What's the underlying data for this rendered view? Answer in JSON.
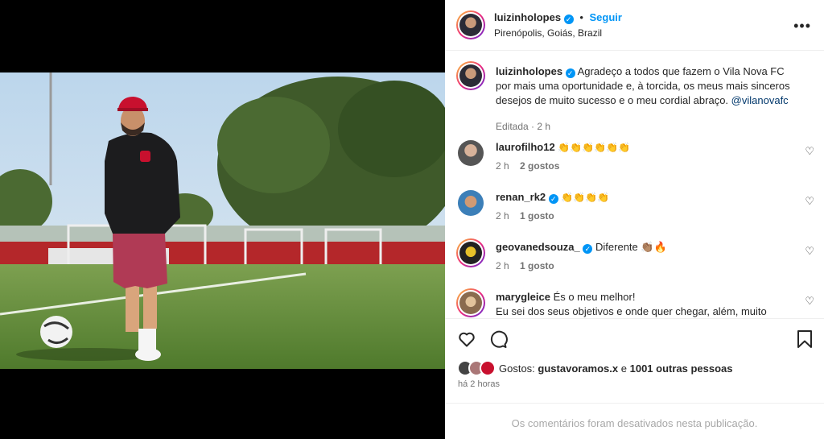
{
  "post": {
    "author": "luizinholopes",
    "follow_label": "Seguir",
    "separator": "•",
    "location": "Pirenópolis, Goiás, Brazil",
    "caption_text": "Agradeço a todos que fazem o Vila Nova FC por mais uma oportunidade e, à torcida, os meus mais sinceros desejos de muito sucesso e o meu cordial abraço.",
    "caption_mention": "@vilanovafc",
    "caption_meta": "Editada · 2 h",
    "more_icon": "more-options-icon"
  },
  "comments": [
    {
      "user": "laurofilho12",
      "verified": false,
      "text": "👏👏👏👏👏👏",
      "time": "2 h",
      "likes": "2 gostos"
    },
    {
      "user": "renan_rk2",
      "verified": true,
      "text": "👏👏👏👏",
      "time": "2 h",
      "likes": "1 gosto"
    },
    {
      "user": "geovanedsouza_",
      "verified": true,
      "text": "Diferente 👏🏽🔥",
      "time": "2 h",
      "likes": "1 gosto"
    },
    {
      "user": "marygleice",
      "verified": false,
      "text": "És o meu melhor!",
      "text2": "Eu sei dos seus objetivos e onde quer chegar, além, muito"
    }
  ],
  "likes": {
    "prefix": "Gostos:",
    "user": "gustavoramos.x",
    "connector": "e",
    "others": "1001 outras pessoas"
  },
  "time_ago": "há 2 horas",
  "comments_disabled": "Os comentários foram desativados nesta publicação.",
  "colors": {
    "accent": "#0095f6",
    "text": "#262626",
    "muted": "#737373",
    "vila_red": "#c8102e"
  }
}
